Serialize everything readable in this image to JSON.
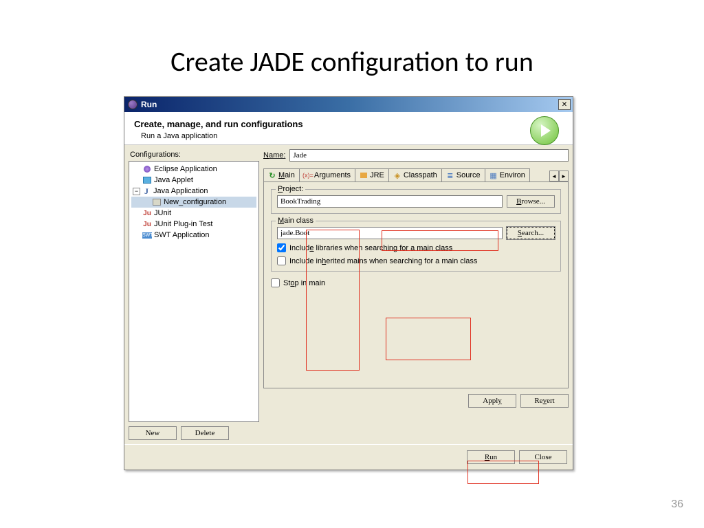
{
  "slide": {
    "title": "Create JADE configuration to run",
    "number": "36"
  },
  "window": {
    "title": "Run",
    "close": "✕"
  },
  "header": {
    "title": "Create, manage, and run configurations",
    "subtitle": "Run a Java application"
  },
  "left": {
    "label": "Configurations:",
    "items": [
      {
        "label": "Eclipse Application"
      },
      {
        "label": "Java Applet"
      },
      {
        "label": "Java Application"
      },
      {
        "label": "New_configuration"
      },
      {
        "label": "JUnit"
      },
      {
        "label": "JUnit Plug-in Test"
      },
      {
        "label": "SWT Application"
      }
    ],
    "new_btn": "New",
    "delete_btn": "Delete"
  },
  "form": {
    "name_label": "Name:",
    "name_value": "Jade",
    "tabs": {
      "main": "Main",
      "arguments": "Arguments",
      "jre": "JRE",
      "classpath": "Classpath",
      "source": "Source",
      "environment": "Environ"
    },
    "project": {
      "label": "Project:",
      "value": "BookTrading",
      "browse": "Browse..."
    },
    "mainclass": {
      "label": "Main class",
      "value": "jade.Boot",
      "search": "Search...",
      "chk1": "Include libraries when searching for a main class",
      "chk2": "Include inherited mains when searching for a main class"
    },
    "stop_in_main": "Stop in main",
    "apply": "Apply",
    "revert": "Revert"
  },
  "footer": {
    "run": "Run",
    "close": "Close"
  }
}
